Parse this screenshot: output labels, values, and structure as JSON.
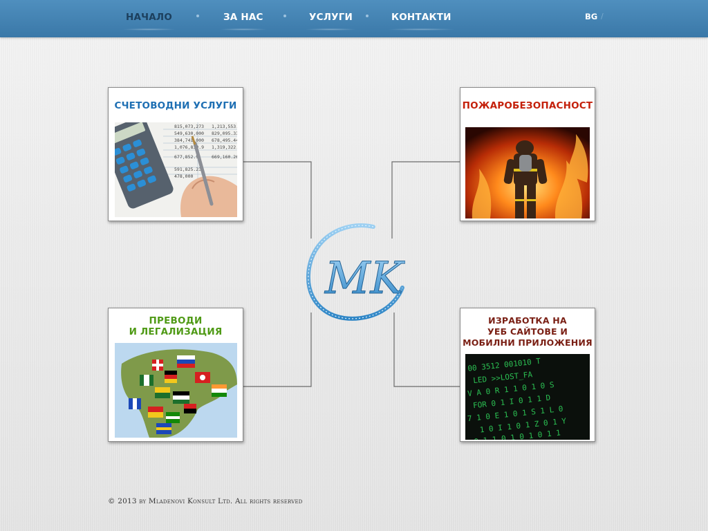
{
  "nav": {
    "items": [
      {
        "label": "НАЧАЛО",
        "active": true
      },
      {
        "label": "ЗА НАС",
        "active": false
      },
      {
        "label": "УСЛУГИ",
        "active": false
      },
      {
        "label": "КОНТАКТИ",
        "active": false
      }
    ],
    "language": "BG",
    "bar_color": "#4083b5"
  },
  "logo": {
    "text": "MK"
  },
  "cards": [
    {
      "title": "СЧЕТОВОДНИ УСЛУГИ",
      "title_color": "#1e6fb3",
      "image": "calculator-ledger-image"
    },
    {
      "title": "ПОЖАРОБЕЗОПАСНОСТ",
      "title_color": "#c4200a",
      "image": "firefighter-flames-image"
    },
    {
      "title_lines": [
        "ПРЕВОДИ",
        "И ЛЕГАЛИЗАЦИЯ"
      ],
      "title_color": "#4f9a16",
      "image": "world-flags-map-image"
    },
    {
      "title_lines": [
        "ИЗРАБОТКА НА",
        "УЕБ САЙТОВЕ И",
        "МОБИЛНИ ПРИЛОЖЕНИЯ"
      ],
      "title_color": "#7a1f14",
      "image": "matrix-code-image"
    }
  ],
  "footer": {
    "text": "© 2013 by Mladenovi Konsult Ltd. All rights reserved"
  }
}
